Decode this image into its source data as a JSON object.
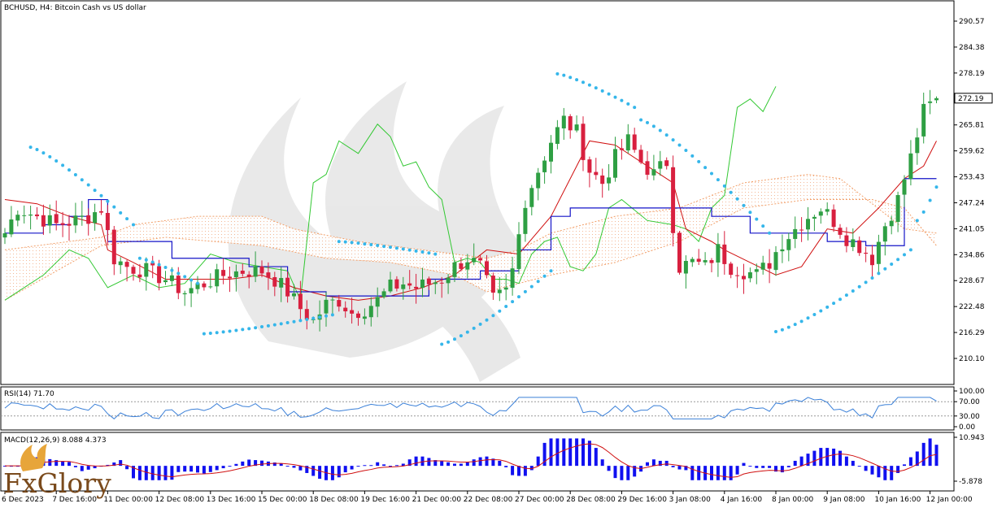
{
  "chart_data": {
    "type": "candlestick",
    "title": "BCHUSD, H4:  Bitcoin Cash vs US dollar",
    "price_axis": {
      "ticks": [
        290.57,
        284.38,
        278.19,
        272.0,
        265.81,
        259.62,
        253.43,
        247.24,
        241.05,
        234.86,
        228.67,
        222.48,
        216.29,
        210.1
      ],
      "tick_labels": [
        "290.57",
        "284.38",
        "278.19",
        "",
        "265.81",
        "259.62",
        "253.43",
        "247.24",
        "241.05",
        "234.86",
        "228.67",
        "222.48",
        "216.29",
        "210.10"
      ],
      "range": [
        203.9,
        294.7
      ],
      "current_price": 272.19,
      "current_price_label": "272.19"
    },
    "time_axis": {
      "labels": [
        "6 Dec 2023",
        "7 Dec 16:00",
        "11 Dec 00:00",
        "12 Dec 08:00",
        "13 Dec 16:00",
        "15 Dec 00:00",
        "18 Dec 08:00",
        "19 Dec 16:00",
        "21 Dec 00:00",
        "22 Dec 08:00",
        "27 Dec 00:00",
        "28 Dec 08:00",
        "29 Dec 16:00",
        "3 Jan 08:00",
        "4 Jan 16:00",
        "8 Jan 00:00",
        "9 Jan 08:00",
        "10 Jan 16:00",
        "12 Jan 00:00"
      ],
      "bar_index": [
        0,
        8,
        16,
        24,
        32,
        40,
        48,
        56,
        64,
        72,
        80,
        88,
        96,
        104,
        112,
        120,
        128,
        136,
        144
      ]
    },
    "price_anchors": [
      [
        0,
        240
      ],
      [
        2,
        246
      ],
      [
        5,
        244
      ],
      [
        8,
        242
      ],
      [
        11,
        243
      ],
      [
        13,
        244
      ],
      [
        15,
        246
      ],
      [
        16,
        240
      ],
      [
        17,
        234
      ],
      [
        19,
        232
      ],
      [
        22,
        231
      ],
      [
        25,
        229
      ],
      [
        28,
        226
      ],
      [
        31,
        228
      ],
      [
        34,
        230
      ],
      [
        37,
        231
      ],
      [
        40,
        231
      ],
      [
        42,
        229
      ],
      [
        44,
        226
      ],
      [
        46,
        222
      ],
      [
        48,
        219
      ],
      [
        50,
        223
      ],
      [
        52,
        224
      ],
      [
        54,
        221
      ],
      [
        56,
        222
      ],
      [
        58,
        224
      ],
      [
        60,
        227
      ],
      [
        62,
        228
      ],
      [
        64,
        227
      ],
      [
        66,
        228
      ],
      [
        68,
        229
      ],
      [
        70,
        232
      ],
      [
        72,
        234
      ],
      [
        74,
        232
      ],
      [
        76,
        224
      ],
      [
        78,
        226
      ],
      [
        79,
        231
      ],
      [
        81,
        248
      ],
      [
        83,
        255
      ],
      [
        85,
        262
      ],
      [
        87,
        267
      ],
      [
        89,
        264
      ],
      [
        91,
        255
      ],
      [
        93,
        252
      ],
      [
        95,
        258
      ],
      [
        97,
        262
      ],
      [
        99,
        257
      ],
      [
        101,
        254
      ],
      [
        103,
        257
      ],
      [
        104,
        242
      ],
      [
        105,
        232
      ],
      [
        107,
        233
      ],
      [
        109,
        232
      ],
      [
        111,
        236
      ],
      [
        113,
        232
      ],
      [
        115,
        231
      ],
      [
        117,
        230
      ],
      [
        119,
        233
      ],
      [
        121,
        238
      ],
      [
        123,
        241
      ],
      [
        125,
        244
      ],
      [
        127,
        246
      ],
      [
        129,
        243
      ],
      [
        131,
        239
      ],
      [
        133,
        237
      ],
      [
        135,
        234
      ],
      [
        137,
        242
      ],
      [
        139,
        248
      ],
      [
        141,
        258
      ],
      [
        143,
        269
      ],
      [
        145,
        272
      ]
    ],
    "volatility": 4.2,
    "seed": 7,
    "ichimoku_cloud": {
      "span_a": [
        [
          0,
          236
        ],
        [
          15,
          239
        ],
        [
          20,
          242
        ],
        [
          30,
          244
        ],
        [
          40,
          244
        ],
        [
          45,
          241
        ],
        [
          55,
          238
        ],
        [
          65,
          236
        ],
        [
          75,
          234
        ],
        [
          80,
          236
        ],
        [
          85,
          240
        ],
        [
          95,
          244
        ],
        [
          105,
          246
        ],
        [
          115,
          252
        ],
        [
          125,
          254
        ],
        [
          130,
          253
        ],
        [
          140,
          241
        ],
        [
          145,
          240
        ]
      ],
      "span_b": [
        [
          0,
          224
        ],
        [
          15,
          237
        ],
        [
          25,
          239
        ],
        [
          40,
          237
        ],
        [
          50,
          234
        ],
        [
          60,
          233
        ],
        [
          70,
          230
        ],
        [
          75,
          226
        ],
        [
          85,
          230
        ],
        [
          95,
          233
        ],
        [
          105,
          238
        ],
        [
          110,
          242
        ],
        [
          115,
          246
        ],
        [
          125,
          248
        ],
        [
          135,
          248
        ],
        [
          140,
          246
        ],
        [
          145,
          237
        ]
      ]
    },
    "tenkan_sen_red": [
      [
        0,
        248
      ],
      [
        5,
        247
      ],
      [
        10,
        244
      ],
      [
        15,
        242
      ],
      [
        16,
        236
      ],
      [
        20,
        233
      ],
      [
        25,
        229
      ],
      [
        30,
        229
      ],
      [
        35,
        229
      ],
      [
        40,
        230
      ],
      [
        45,
        227
      ],
      [
        50,
        225
      ],
      [
        55,
        224
      ],
      [
        60,
        225
      ],
      [
        65,
        227
      ],
      [
        70,
        230
      ],
      [
        75,
        236
      ],
      [
        80,
        235
      ],
      [
        85,
        244
      ],
      [
        88,
        253
      ],
      [
        91,
        262
      ],
      [
        95,
        261
      ],
      [
        100,
        256
      ],
      [
        104,
        252
      ],
      [
        106,
        241
      ],
      [
        110,
        238
      ],
      [
        112,
        236
      ],
      [
        116,
        233
      ],
      [
        120,
        230
      ],
      [
        124,
        232
      ],
      [
        128,
        241
      ],
      [
        132,
        240
      ],
      [
        136,
        246
      ],
      [
        140,
        253
      ],
      [
        143,
        256
      ],
      [
        145,
        262
      ]
    ],
    "kijun_sen_blue": [
      [
        0,
        240
      ],
      [
        6,
        242
      ],
      [
        10,
        244
      ],
      [
        13,
        248
      ],
      [
        16,
        238
      ],
      [
        20,
        238
      ],
      [
        26,
        234
      ],
      [
        32,
        234
      ],
      [
        38,
        232
      ],
      [
        44,
        226
      ],
      [
        50,
        225
      ],
      [
        56,
        225
      ],
      [
        62,
        225
      ],
      [
        66,
        229
      ],
      [
        70,
        229
      ],
      [
        74,
        231
      ],
      [
        80,
        236
      ],
      [
        85,
        244
      ],
      [
        88,
        246
      ],
      [
        100,
        246
      ],
      [
        105,
        246
      ],
      [
        110,
        244
      ],
      [
        116,
        240
      ],
      [
        128,
        238
      ],
      [
        134,
        237
      ],
      [
        136,
        237
      ],
      [
        140,
        253
      ],
      [
        145,
        253
      ]
    ],
    "chikou_green": [
      [
        0,
        224
      ],
      [
        6,
        230
      ],
      [
        10,
        236
      ],
      [
        13,
        234
      ],
      [
        16,
        227
      ],
      [
        20,
        230
      ],
      [
        24,
        227
      ],
      [
        28,
        228
      ],
      [
        32,
        235
      ],
      [
        36,
        233
      ],
      [
        40,
        232
      ],
      [
        44,
        231
      ],
      [
        46,
        224
      ],
      [
        48,
        252
      ],
      [
        50,
        254
      ],
      [
        52,
        262
      ],
      [
        55,
        259
      ],
      [
        58,
        266
      ],
      [
        60,
        263
      ],
      [
        62,
        256
      ],
      [
        64,
        257
      ],
      [
        66,
        251
      ],
      [
        68,
        248
      ],
      [
        70,
        233
      ],
      [
        72,
        234
      ],
      [
        74,
        233
      ],
      [
        76,
        229
      ],
      [
        78,
        229
      ],
      [
        80,
        228
      ],
      [
        82,
        235
      ],
      [
        84,
        238
      ],
      [
        86,
        239
      ],
      [
        88,
        232
      ],
      [
        90,
        231
      ],
      [
        92,
        235
      ],
      [
        94,
        246
      ],
      [
        96,
        248
      ],
      [
        100,
        243
      ],
      [
        104,
        242
      ],
      [
        106,
        241
      ],
      [
        108,
        238
      ],
      [
        110,
        246
      ],
      [
        112,
        249
      ],
      [
        114,
        270
      ],
      [
        116,
        272
      ],
      [
        118,
        269
      ],
      [
        120,
        275
      ]
    ],
    "parabolic_sar": [
      [
        [
          4,
          260.5
        ],
        [
          20,
          242
        ]
      ],
      [
        [
          21,
          234
        ],
        [
          30,
          228
        ]
      ],
      [
        [
          31,
          216
        ],
        [
          51,
          220.5
        ]
      ],
      [
        [
          52,
          238
        ],
        [
          67,
          235
        ]
      ],
      [
        [
          68,
          213.5
        ],
        [
          85,
          231
        ]
      ],
      [
        [
          86,
          278
        ],
        [
          98,
          270
        ]
      ],
      [
        [
          99,
          267
        ],
        [
          119,
          240
        ]
      ],
      [
        [
          120,
          216.5
        ],
        [
          141,
          236
        ]
      ],
      [
        [
          142,
          243
        ],
        [
          145,
          251
        ]
      ]
    ],
    "rsi": {
      "label": "RSI(14) 71.70",
      "value": 71.7,
      "levels": [
        100.0,
        70.0,
        30.0,
        0.0
      ],
      "level_labels": [
        "100.00",
        "70.00",
        "30.00",
        "0.00"
      ],
      "range": [
        0,
        100
      ]
    },
    "macd": {
      "label": "MACD(12,26,9) 8.088 4.373",
      "main": 8.088,
      "signal": 4.373,
      "axis_labels": [
        "10.943",
        "-5.878"
      ],
      "range": [
        -5.878,
        10.943
      ]
    },
    "colors": {
      "bull": "#2e9f43",
      "bear": "#d8203f",
      "tenkan": "#d01010",
      "kijun": "#1414c8",
      "chikou": "#32c832",
      "cloud": "#f2a06a",
      "sar": "#35b6ea",
      "rsi": "#3b80d8",
      "macd_hist": "#1010f0",
      "macd_signal": "#d01010"
    },
    "logo": "FxGlory"
  }
}
